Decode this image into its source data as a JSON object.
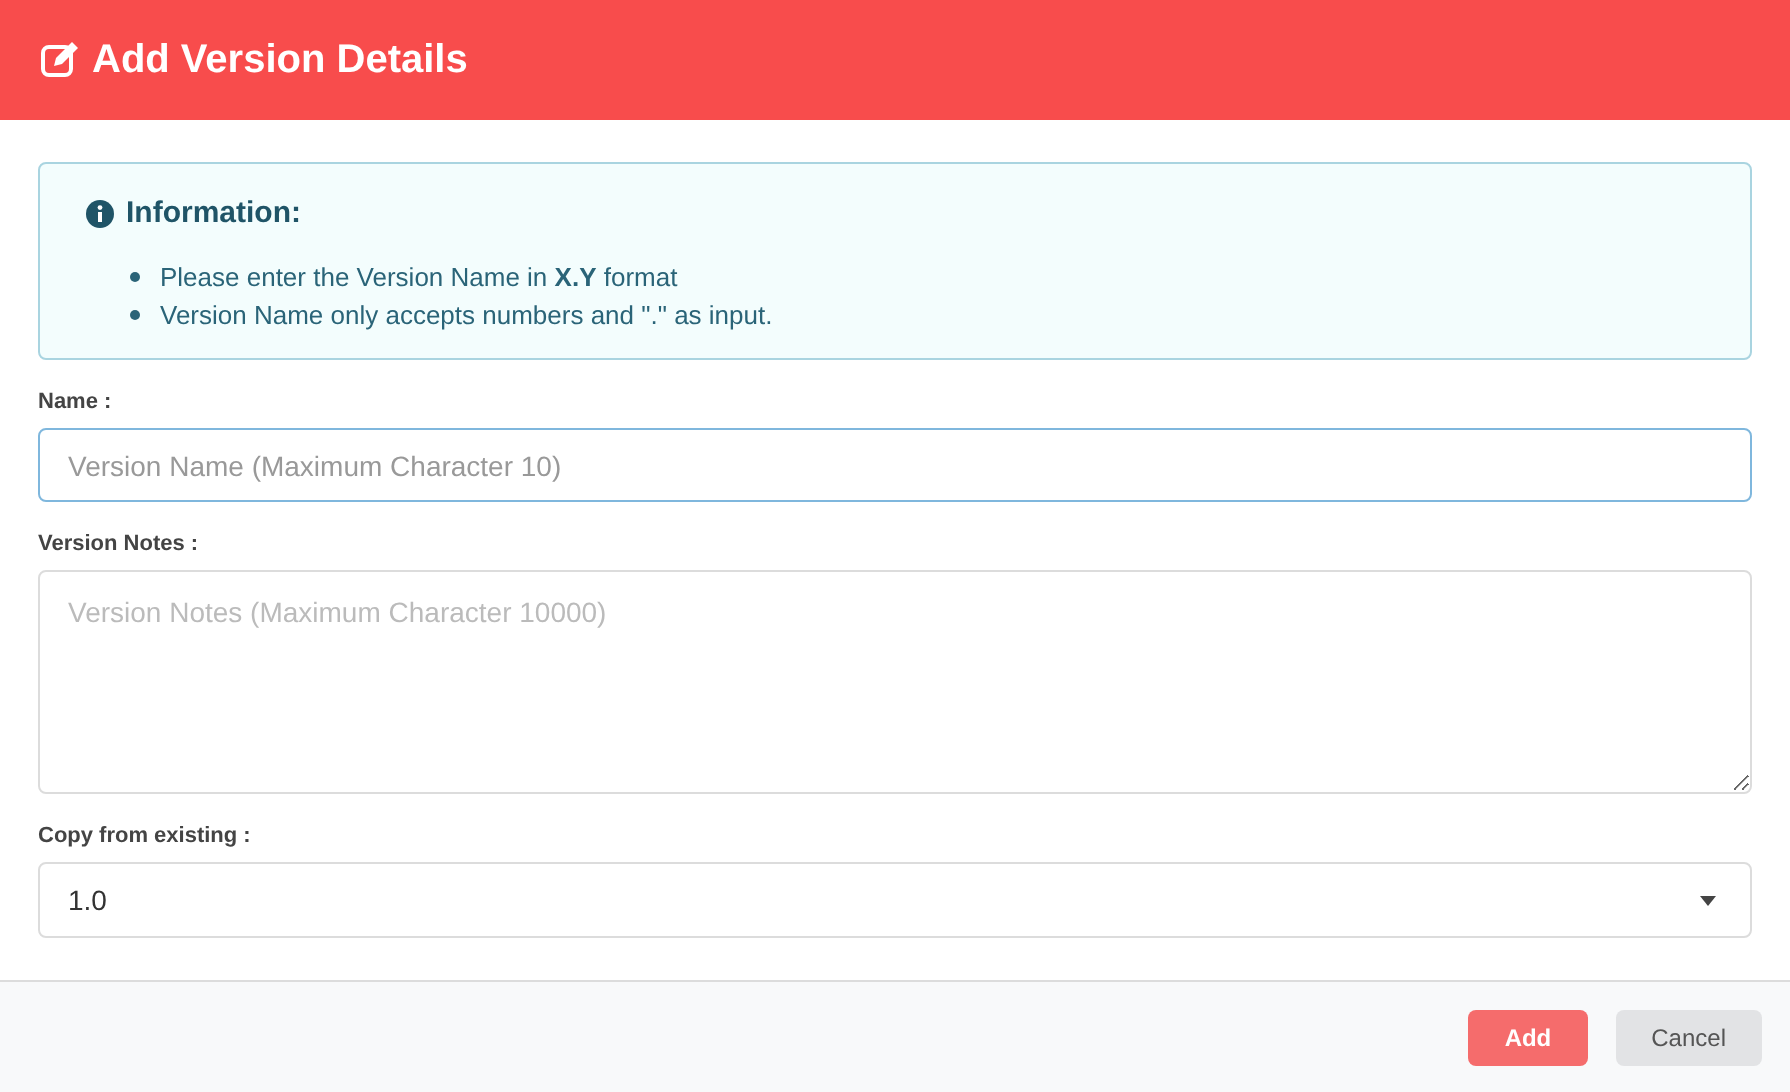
{
  "dialog": {
    "title": "Add Version Details"
  },
  "info": {
    "heading": "Information:",
    "items": [
      "Please enter the Version Name in **X.Y** format",
      "Version Name only accepts numbers and \".\" as input."
    ]
  },
  "fields": [
    {
      "kind": "input",
      "label": "Name :",
      "placeholder": "Version Name (Maximum Character 10)",
      "focused": true
    },
    {
      "kind": "textarea",
      "label": "Version Notes :",
      "placeholder": "Version Notes (Maximum Character 10000)",
      "focused": false
    },
    {
      "kind": "select",
      "label": "Copy from existing :",
      "value": "1.0",
      "focused": false
    }
  ],
  "buttons": [
    {
      "label": "Add",
      "kind": "primary"
    },
    {
      "label": "Cancel",
      "kind": "secondary"
    }
  ]
}
